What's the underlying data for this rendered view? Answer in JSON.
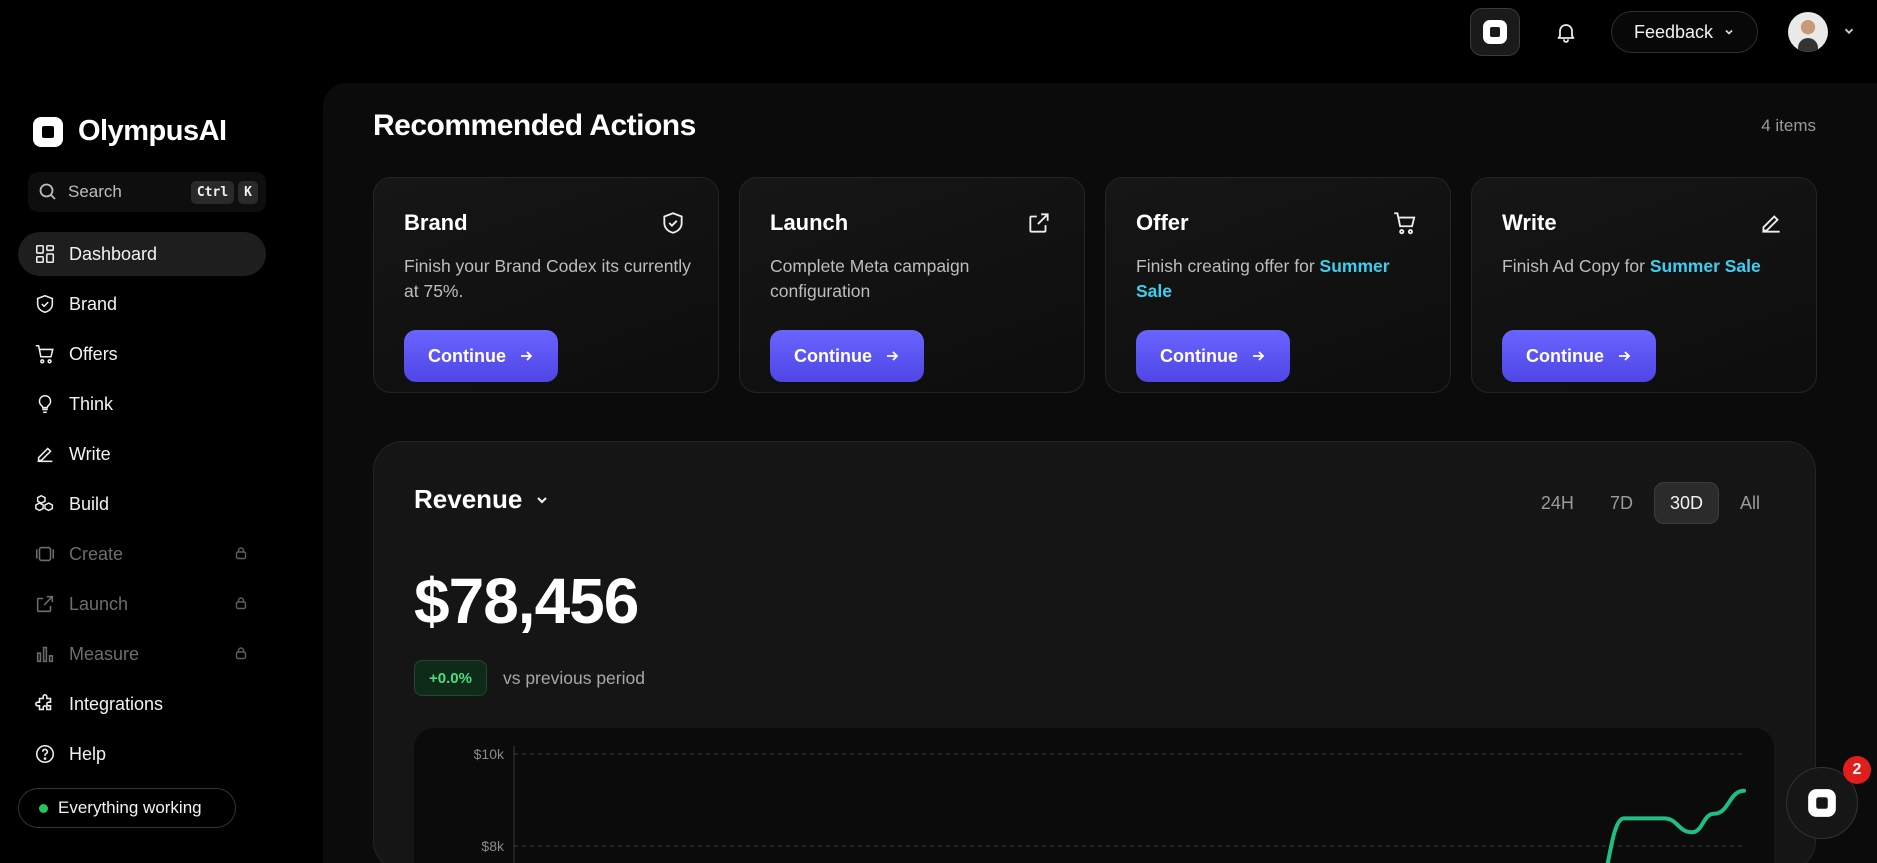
{
  "topbar": {
    "feedback_label": "Feedback"
  },
  "sidebar": {
    "brand_name": "OlympusAI",
    "search": {
      "placeholder": "Search",
      "shortcut": [
        "Ctrl",
        "K"
      ]
    },
    "items": [
      {
        "label": "Dashboard",
        "icon": "dashboard-icon",
        "active": true,
        "locked": false
      },
      {
        "label": "Brand",
        "icon": "shield-check-icon",
        "active": false,
        "locked": false
      },
      {
        "label": "Offers",
        "icon": "cart-icon",
        "active": false,
        "locked": false
      },
      {
        "label": "Think",
        "icon": "lightbulb-icon",
        "active": false,
        "locked": false
      },
      {
        "label": "Write",
        "icon": "pencil-icon",
        "active": false,
        "locked": false
      },
      {
        "label": "Build",
        "icon": "boxes-icon",
        "active": false,
        "locked": false
      },
      {
        "label": "Create",
        "icon": "film-icon",
        "active": false,
        "locked": true
      },
      {
        "label": "Launch",
        "icon": "external-link-icon",
        "active": false,
        "locked": true
      },
      {
        "label": "Measure",
        "icon": "bar-chart-icon",
        "active": false,
        "locked": true
      },
      {
        "label": "Integrations",
        "icon": "puzzle-icon",
        "active": false,
        "locked": false
      },
      {
        "label": "Help",
        "icon": "help-circle-icon",
        "active": false,
        "locked": false
      }
    ],
    "status": "Everything working"
  },
  "recommended": {
    "title": "Recommended Actions",
    "count": "4 items",
    "cards": [
      {
        "title": "Brand",
        "icon": "shield-check-icon",
        "desc": "Finish your Brand Codex its currently at 75%.",
        "highlight": "",
        "button": "Continue"
      },
      {
        "title": "Launch",
        "icon": "external-link-icon",
        "desc": "Complete Meta campaign configuration",
        "highlight": "",
        "button": "Continue"
      },
      {
        "title": "Offer",
        "icon": "cart-icon",
        "desc": "Finish creating offer for ",
        "highlight": "Summer Sale",
        "button": "Continue"
      },
      {
        "title": "Write",
        "icon": "pencil-icon",
        "desc": "Finish Ad Copy for ",
        "highlight": "Summer Sale",
        "button": "Continue"
      }
    ]
  },
  "revenue": {
    "title": "Revenue",
    "ranges": [
      "24H",
      "7D",
      "30D",
      "All"
    ],
    "active_range": "30D",
    "value": "$78,456",
    "delta": "+0.0%",
    "delta_label": "vs previous period"
  },
  "chart_data": {
    "type": "line",
    "title": "",
    "xlabel": "",
    "ylabel": "",
    "yticks": [
      "$10k",
      "$8k"
    ],
    "series_color": "#1fbf83",
    "series": [
      {
        "values": [
          7800,
          8600,
          8600,
          8300,
          8700,
          9200
        ]
      }
    ]
  },
  "chat": {
    "badge": "2"
  },
  "colors": {
    "accent": "#5b54f5",
    "highlight": "#3ecff0",
    "success": "#22c55e"
  }
}
